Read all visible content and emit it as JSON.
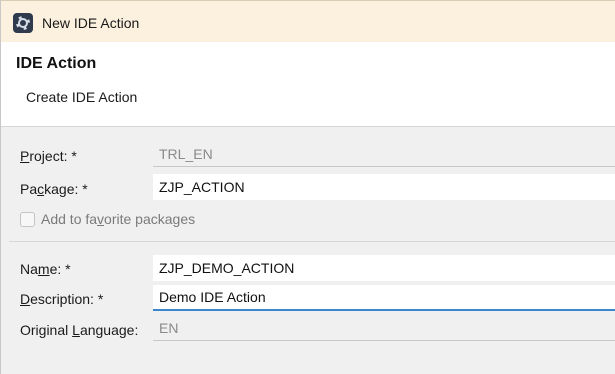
{
  "window": {
    "title": "New IDE Action",
    "icon": "eclipse-gear-icon"
  },
  "header": {
    "title": "IDE Action",
    "subtitle": "Create IDE Action"
  },
  "form": {
    "project": {
      "label_pre": "",
      "label_mn": "P",
      "label_post": "roject: *",
      "value": "TRL_EN"
    },
    "package": {
      "label_pre": "Pa",
      "label_mn": "c",
      "label_post": "kage: *",
      "value": "ZJP_ACTION"
    },
    "favorite": {
      "label_pre": "Add to fa",
      "label_mn": "v",
      "label_post": "orite packages",
      "checked": false
    },
    "name": {
      "label_pre": "Na",
      "label_mn": "m",
      "label_post": "e: *",
      "value": "ZJP_DEMO_ACTION"
    },
    "description": {
      "label_pre": "",
      "label_mn": "D",
      "label_post": "escription: *",
      "value": "Demo IDE Action"
    },
    "language": {
      "label_pre": "Original ",
      "label_mn": "L",
      "label_post": "anguage:",
      "value": "EN"
    }
  },
  "colors": {
    "titlebar_bg": "#fbf1de",
    "focus_accent": "#3a86d0",
    "dialog_bg": "#f0f0f0"
  }
}
